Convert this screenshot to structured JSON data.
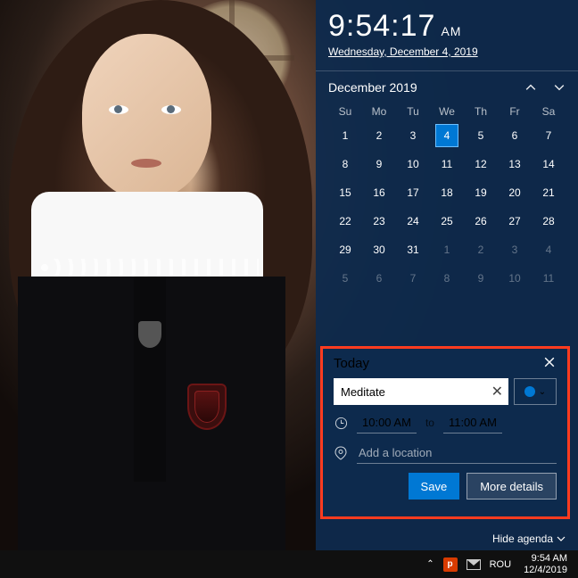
{
  "clock": {
    "time": "9:54:17",
    "ampm": "AM",
    "date": "Wednesday, December 4, 2019"
  },
  "calendar": {
    "month_label": "December 2019",
    "dow": [
      "Su",
      "Mo",
      "Tu",
      "We",
      "Th",
      "Fr",
      "Sa"
    ],
    "weeks": [
      [
        {
          "n": 1
        },
        {
          "n": 2
        },
        {
          "n": 3
        },
        {
          "n": 4,
          "today": true
        },
        {
          "n": 5
        },
        {
          "n": 6
        },
        {
          "n": 7
        }
      ],
      [
        {
          "n": 8
        },
        {
          "n": 9
        },
        {
          "n": 10
        },
        {
          "n": 11
        },
        {
          "n": 12
        },
        {
          "n": 13
        },
        {
          "n": 14
        }
      ],
      [
        {
          "n": 15
        },
        {
          "n": 16
        },
        {
          "n": 17
        },
        {
          "n": 18
        },
        {
          "n": 19
        },
        {
          "n": 20
        },
        {
          "n": 21
        }
      ],
      [
        {
          "n": 22
        },
        {
          "n": 23
        },
        {
          "n": 24
        },
        {
          "n": 25
        },
        {
          "n": 26
        },
        {
          "n": 27
        },
        {
          "n": 28
        }
      ],
      [
        {
          "n": 29
        },
        {
          "n": 30
        },
        {
          "n": 31
        },
        {
          "n": 1,
          "dim": true
        },
        {
          "n": 2,
          "dim": true
        },
        {
          "n": 3,
          "dim": true
        },
        {
          "n": 4,
          "dim": true
        }
      ],
      [
        {
          "n": 5,
          "dim": true
        },
        {
          "n": 6,
          "dim": true
        },
        {
          "n": 7,
          "dim": true
        },
        {
          "n": 8,
          "dim": true
        },
        {
          "n": 9,
          "dim": true
        },
        {
          "n": 10,
          "dim": true
        },
        {
          "n": 11,
          "dim": true
        }
      ]
    ]
  },
  "agenda": {
    "header": "Today",
    "event_title": "Meditate",
    "start": "10:00 AM",
    "to": "to",
    "end": "11:00 AM",
    "location_placeholder": "Add a location",
    "save": "Save",
    "more": "More details",
    "hide": "Hide agenda",
    "color": "#0078d4"
  },
  "taskbar": {
    "lang": "ROU",
    "time": "9:54 AM",
    "date": "12/4/2019"
  }
}
